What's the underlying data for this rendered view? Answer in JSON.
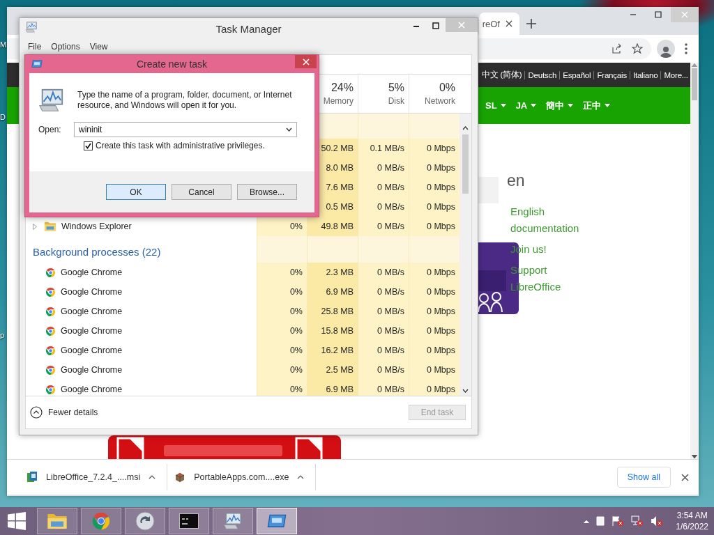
{
  "desktop": {
    "icon_labels": [
      "M",
      "D",
      "p"
    ]
  },
  "browser": {
    "tab": {
      "title": "reOf"
    },
    "language_links": [
      "中文 (简体)",
      "Deutsch",
      "Español",
      "Français",
      "Italiano",
      "More..."
    ],
    "nav_items": [
      "SL",
      "JA",
      "簡中",
      "正中"
    ],
    "heading": "en",
    "links": [
      "English documentation",
      "Join us!",
      "Support LibreOffice"
    ],
    "downloads": [
      {
        "kind": "installer",
        "name": "LibreOffice_7.2.4_....msi"
      },
      {
        "kind": "package",
        "name": "PortableApps.com....exe"
      }
    ],
    "show_all": "Show all"
  },
  "task_manager": {
    "title": "Task Manager",
    "menu": [
      "File",
      "Options",
      "View"
    ],
    "columns": [
      {
        "percent": "24%",
        "label": "Memory"
      },
      {
        "percent": "5%",
        "label": "Disk"
      },
      {
        "percent": "0%",
        "label": "Network"
      }
    ],
    "groups": [
      {
        "rows": [
          {
            "memory": "50.2 MB",
            "disk": "0.1 MB/s",
            "network": "0 Mbps"
          },
          {
            "memory": "8.0 MB",
            "disk": "0 MB/s",
            "network": "0 Mbps"
          },
          {
            "memory": "7.6 MB",
            "disk": "0 MB/s",
            "network": "0 Mbps"
          },
          {
            "memory": "0.5 MB",
            "disk": "0 MB/s",
            "network": "0 Mbps"
          },
          {
            "kind": "explorer",
            "name": "Windows Explorer",
            "expandable": true,
            "cpu": "0%",
            "memory": "49.8 MB",
            "disk": "0 MB/s",
            "network": "0 Mbps"
          }
        ]
      },
      {
        "title": "Background processes (22)",
        "rows": [
          {
            "kind": "chrome",
            "name": "Google Chrome",
            "expandable": false,
            "cpu": "0%",
            "memory": "2.3 MB",
            "disk": "0 MB/s",
            "network": "0 Mbps"
          },
          {
            "kind": "chrome",
            "name": "Google Chrome",
            "expandable": false,
            "cpu": "0%",
            "memory": "6.9 MB",
            "disk": "0 MB/s",
            "network": "0 Mbps"
          },
          {
            "kind": "chrome",
            "name": "Google Chrome",
            "expandable": false,
            "cpu": "0%",
            "memory": "25.8 MB",
            "disk": "0 MB/s",
            "network": "0 Mbps"
          },
          {
            "kind": "chrome",
            "name": "Google Chrome",
            "expandable": false,
            "cpu": "0%",
            "memory": "15.8 MB",
            "disk": "0 MB/s",
            "network": "0 Mbps"
          },
          {
            "kind": "chrome",
            "name": "Google Chrome",
            "expandable": false,
            "cpu": "0%",
            "memory": "16.2 MB",
            "disk": "0 MB/s",
            "network": "0 Mbps"
          },
          {
            "kind": "chrome",
            "name": "Google Chrome",
            "expandable": false,
            "cpu": "0%",
            "memory": "2.5 MB",
            "disk": "0 MB/s",
            "network": "0 Mbps"
          },
          {
            "kind": "chrome",
            "name": "Google Chrome",
            "expandable": false,
            "cpu": "0%",
            "memory": "6.9 MB",
            "disk": "0 MB/s",
            "network": "0 Mbps"
          }
        ]
      }
    ],
    "fewer_details": "Fewer details",
    "end_task": {
      "label": "End task",
      "disabled": true
    }
  },
  "dialog": {
    "title": "Create new task",
    "description": "Type the name of a program, folder, document, or Internet resource, and Windows will open it for you.",
    "open_label": "Open:",
    "value": "wininit",
    "admin": {
      "label": "Create this task with administrative privileges.",
      "checked": true
    },
    "buttons": [
      {
        "label": "OK",
        "default": true
      },
      {
        "label": "Cancel",
        "default": false
      },
      {
        "label": "Browse...",
        "default": false
      }
    ]
  },
  "taskbar": {
    "apps": [
      {
        "kind": "explorer",
        "selected": false
      },
      {
        "kind": "chrome",
        "selected": false
      },
      {
        "kind": "sync",
        "selected": false
      },
      {
        "kind": "terminal",
        "selected": false
      },
      {
        "kind": "monitor",
        "selected": false
      },
      {
        "kind": "run",
        "selected": true
      }
    ],
    "clock": {
      "time": "3:54 AM",
      "date": "1/6/2022"
    }
  }
}
